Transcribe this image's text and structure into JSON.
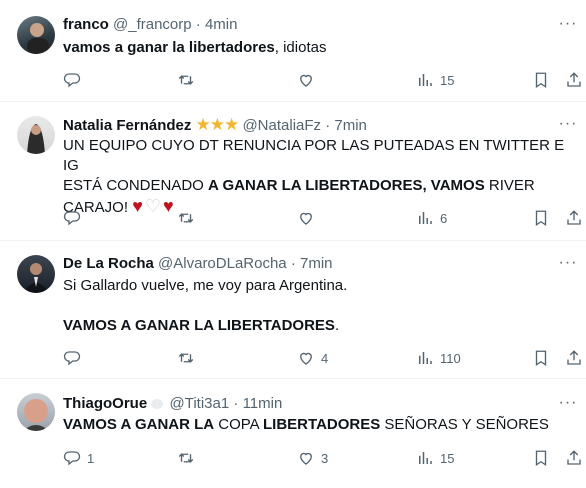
{
  "tweets": [
    {
      "name": "franco",
      "handle": "@_francorp",
      "dot": "·",
      "time": "4min",
      "body": [
        {
          "bold": "vamos a ganar la libertadores",
          "text": ", idiotas"
        }
      ],
      "replies": "",
      "retweets": "",
      "likes": "",
      "views": "15",
      "stars": ""
    },
    {
      "name": "Natalia Fernández",
      "stars": "★★★",
      "handle": "@NataliaFz",
      "dot": "·",
      "time": "7min",
      "body_lines": [
        "UN EQUIPO CUYO DT RENUNCIA POR LAS PUTEADAS EN TWITTER E IG",
        "ESTÁ CONDENADO ",
        "A GANAR LA LIBERTADORES, VAMOS",
        " RIVER",
        "CARAJO! ",
        "♥",
        "♡",
        "♥"
      ],
      "replies": "",
      "retweets": "",
      "likes": "",
      "views": "6"
    },
    {
      "name": "De La Rocha",
      "handle": "@AlvaroDLaRocha",
      "dot": "·",
      "time": "7min",
      "line1": "Si Gallardo vuelve, me voy para Argentina.",
      "line2": "VAMOS A GANAR LA LIBERTADORES",
      "line2_end": ".",
      "replies": "",
      "retweets": "",
      "likes": "4",
      "views": "110"
    },
    {
      "name": "ThiagoOrue",
      "handle": "@Titi3a1",
      "dot": "·",
      "time": "11min",
      "parts": [
        "VAMOS A GANAR LA",
        " COPA ",
        "LIBERTADORES",
        " SEÑORAS Y SEÑORES"
      ],
      "replies": "1",
      "retweets": "",
      "likes": "3",
      "views": "15"
    }
  ],
  "colors": {
    "text": "#0f1419",
    "secondary": "#536471",
    "separator": "#eff3f4",
    "star": "#f2b632",
    "heart_red": "#c1121f"
  }
}
